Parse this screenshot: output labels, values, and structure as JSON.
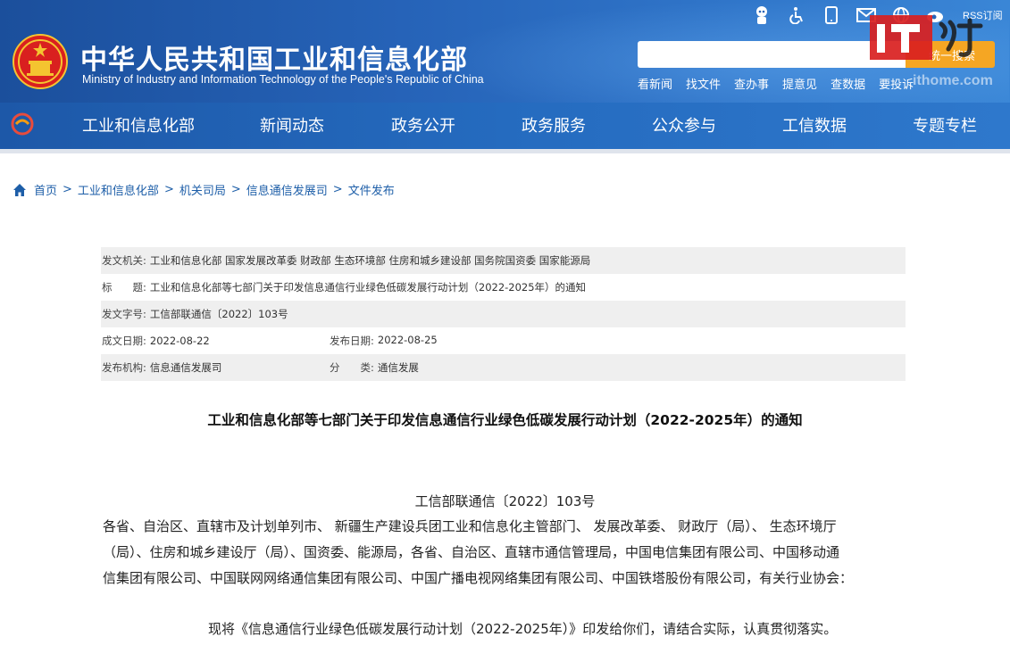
{
  "header": {
    "site_title": "中华人民共和国工业和信息化部",
    "site_subtitle": "Ministry of Industry and Information Technology of the People's Republic of China",
    "rss_label": "RSS订阅",
    "search_placeholder": "",
    "search_button": "统一搜索",
    "quick_links": [
      "看新闻",
      "找文件",
      "查办事",
      "提意见",
      "查数据",
      "要投诉"
    ],
    "icons": [
      "robot-icon",
      "accessibility-icon",
      "mobile-icon",
      "mail-icon",
      "globe-icon",
      "weibo-icon",
      "rss-icon"
    ],
    "watermark_domain": "ithome.com"
  },
  "nav": {
    "items": [
      "工业和信息化部",
      "新闻动态",
      "政务公开",
      "政务服务",
      "公众参与",
      "工信数据",
      "专题专栏"
    ]
  },
  "breadcrumb": {
    "items": [
      "首页",
      "工业和信息化部",
      "机关司局",
      "信息通信发展司",
      "文件发布"
    ],
    "separator": ">"
  },
  "meta": {
    "issuing_label": "发文机关:",
    "issuing_value": "工业和信息化部 国家发展改革委 财政部 生态环境部 住房和城乡建设部 国务院国资委 国家能源局",
    "title_label": "标　　题:",
    "title_value": "工业和信息化部等七部门关于印发信息通信行业绿色低碳发展行动计划（2022-2025年）的通知",
    "docno_label": "发文字号:",
    "docno_value": "工信部联通信〔2022〕103号",
    "created_label": "成文日期:",
    "created_value": "2022-08-22",
    "published_label": "发布日期:",
    "published_value": "2022-08-25",
    "org_label": "发布机构:",
    "org_value": "信息通信发展司",
    "category_label": "分　　类:",
    "category_value": "通信发展"
  },
  "document": {
    "title": "工业和信息化部等七部门关于印发信息通信行业绿色低碳发展行动计划（2022-2025年）的通知",
    "number": "工信部联通信〔2022〕103号",
    "recipients_line1": "各省、自治区、直辖市及计划单列市、 新疆生产建设兵团工业和信息化主管部门、 发展改革委、 财政厅（局）、 生态环境厅",
    "recipients_line2": "（局）、住房和城乡建设厅（局）、国资委、能源局，各省、自治区、直辖市通信管理局，中国电信集团有限公司、中国移动通",
    "recipients_line3": "信集团有限公司、中国联网网络通信集团有限公司、中国广播电视网络集团有限公司、中国铁塔股份有限公司，有关行业协会：",
    "body": "现将《信息通信行业绿色低碳发展行动计划（2022-2025年）》印发给你们，请结合实际，认真贯彻落实。"
  },
  "colors": {
    "header_blue": "#2663b8",
    "nav_blue": "#256bbf",
    "link_blue": "#1d5ea8",
    "search_orange": "#f5a623",
    "watermark_red": "#d9201f"
  }
}
